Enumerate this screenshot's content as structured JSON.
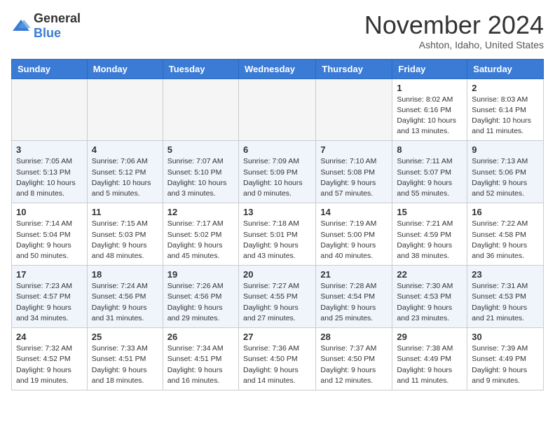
{
  "logo": {
    "general": "General",
    "blue": "Blue"
  },
  "header": {
    "month": "November 2024",
    "location": "Ashton, Idaho, United States"
  },
  "weekdays": [
    "Sunday",
    "Monday",
    "Tuesday",
    "Wednesday",
    "Thursday",
    "Friday",
    "Saturday"
  ],
  "weeks": [
    [
      {
        "day": "",
        "info": ""
      },
      {
        "day": "",
        "info": ""
      },
      {
        "day": "",
        "info": ""
      },
      {
        "day": "",
        "info": ""
      },
      {
        "day": "",
        "info": ""
      },
      {
        "day": "1",
        "info": "Sunrise: 8:02 AM\nSunset: 6:16 PM\nDaylight: 10 hours and 13 minutes."
      },
      {
        "day": "2",
        "info": "Sunrise: 8:03 AM\nSunset: 6:14 PM\nDaylight: 10 hours and 11 minutes."
      }
    ],
    [
      {
        "day": "3",
        "info": "Sunrise: 7:05 AM\nSunset: 5:13 PM\nDaylight: 10 hours and 8 minutes."
      },
      {
        "day": "4",
        "info": "Sunrise: 7:06 AM\nSunset: 5:12 PM\nDaylight: 10 hours and 5 minutes."
      },
      {
        "day": "5",
        "info": "Sunrise: 7:07 AM\nSunset: 5:10 PM\nDaylight: 10 hours and 3 minutes."
      },
      {
        "day": "6",
        "info": "Sunrise: 7:09 AM\nSunset: 5:09 PM\nDaylight: 10 hours and 0 minutes."
      },
      {
        "day": "7",
        "info": "Sunrise: 7:10 AM\nSunset: 5:08 PM\nDaylight: 9 hours and 57 minutes."
      },
      {
        "day": "8",
        "info": "Sunrise: 7:11 AM\nSunset: 5:07 PM\nDaylight: 9 hours and 55 minutes."
      },
      {
        "day": "9",
        "info": "Sunrise: 7:13 AM\nSunset: 5:06 PM\nDaylight: 9 hours and 52 minutes."
      }
    ],
    [
      {
        "day": "10",
        "info": "Sunrise: 7:14 AM\nSunset: 5:04 PM\nDaylight: 9 hours and 50 minutes."
      },
      {
        "day": "11",
        "info": "Sunrise: 7:15 AM\nSunset: 5:03 PM\nDaylight: 9 hours and 48 minutes."
      },
      {
        "day": "12",
        "info": "Sunrise: 7:17 AM\nSunset: 5:02 PM\nDaylight: 9 hours and 45 minutes."
      },
      {
        "day": "13",
        "info": "Sunrise: 7:18 AM\nSunset: 5:01 PM\nDaylight: 9 hours and 43 minutes."
      },
      {
        "day": "14",
        "info": "Sunrise: 7:19 AM\nSunset: 5:00 PM\nDaylight: 9 hours and 40 minutes."
      },
      {
        "day": "15",
        "info": "Sunrise: 7:21 AM\nSunset: 4:59 PM\nDaylight: 9 hours and 38 minutes."
      },
      {
        "day": "16",
        "info": "Sunrise: 7:22 AM\nSunset: 4:58 PM\nDaylight: 9 hours and 36 minutes."
      }
    ],
    [
      {
        "day": "17",
        "info": "Sunrise: 7:23 AM\nSunset: 4:57 PM\nDaylight: 9 hours and 34 minutes."
      },
      {
        "day": "18",
        "info": "Sunrise: 7:24 AM\nSunset: 4:56 PM\nDaylight: 9 hours and 31 minutes."
      },
      {
        "day": "19",
        "info": "Sunrise: 7:26 AM\nSunset: 4:56 PM\nDaylight: 9 hours and 29 minutes."
      },
      {
        "day": "20",
        "info": "Sunrise: 7:27 AM\nSunset: 4:55 PM\nDaylight: 9 hours and 27 minutes."
      },
      {
        "day": "21",
        "info": "Sunrise: 7:28 AM\nSunset: 4:54 PM\nDaylight: 9 hours and 25 minutes."
      },
      {
        "day": "22",
        "info": "Sunrise: 7:30 AM\nSunset: 4:53 PM\nDaylight: 9 hours and 23 minutes."
      },
      {
        "day": "23",
        "info": "Sunrise: 7:31 AM\nSunset: 4:53 PM\nDaylight: 9 hours and 21 minutes."
      }
    ],
    [
      {
        "day": "24",
        "info": "Sunrise: 7:32 AM\nSunset: 4:52 PM\nDaylight: 9 hours and 19 minutes."
      },
      {
        "day": "25",
        "info": "Sunrise: 7:33 AM\nSunset: 4:51 PM\nDaylight: 9 hours and 18 minutes."
      },
      {
        "day": "26",
        "info": "Sunrise: 7:34 AM\nSunset: 4:51 PM\nDaylight: 9 hours and 16 minutes."
      },
      {
        "day": "27",
        "info": "Sunrise: 7:36 AM\nSunset: 4:50 PM\nDaylight: 9 hours and 14 minutes."
      },
      {
        "day": "28",
        "info": "Sunrise: 7:37 AM\nSunset: 4:50 PM\nDaylight: 9 hours and 12 minutes."
      },
      {
        "day": "29",
        "info": "Sunrise: 7:38 AM\nSunset: 4:49 PM\nDaylight: 9 hours and 11 minutes."
      },
      {
        "day": "30",
        "info": "Sunrise: 7:39 AM\nSunset: 4:49 PM\nDaylight: 9 hours and 9 minutes."
      }
    ]
  ]
}
